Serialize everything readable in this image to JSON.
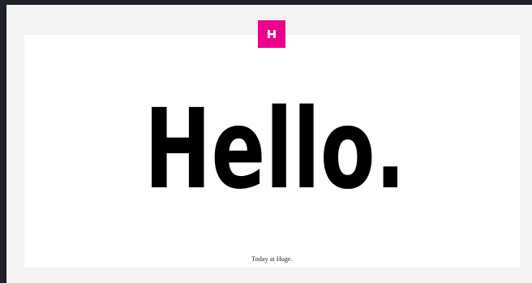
{
  "logo": {
    "letter": "H",
    "color": "#ec008c",
    "icon": "huge-h-logo"
  },
  "hero": {
    "headline": "Hello."
  },
  "footer": {
    "tagline": "Today at Huge."
  },
  "colors": {
    "frame_background": "#1e2128",
    "page_background": "#f3f3f3",
    "card_background": "#ffffff",
    "headline": "#000000"
  }
}
